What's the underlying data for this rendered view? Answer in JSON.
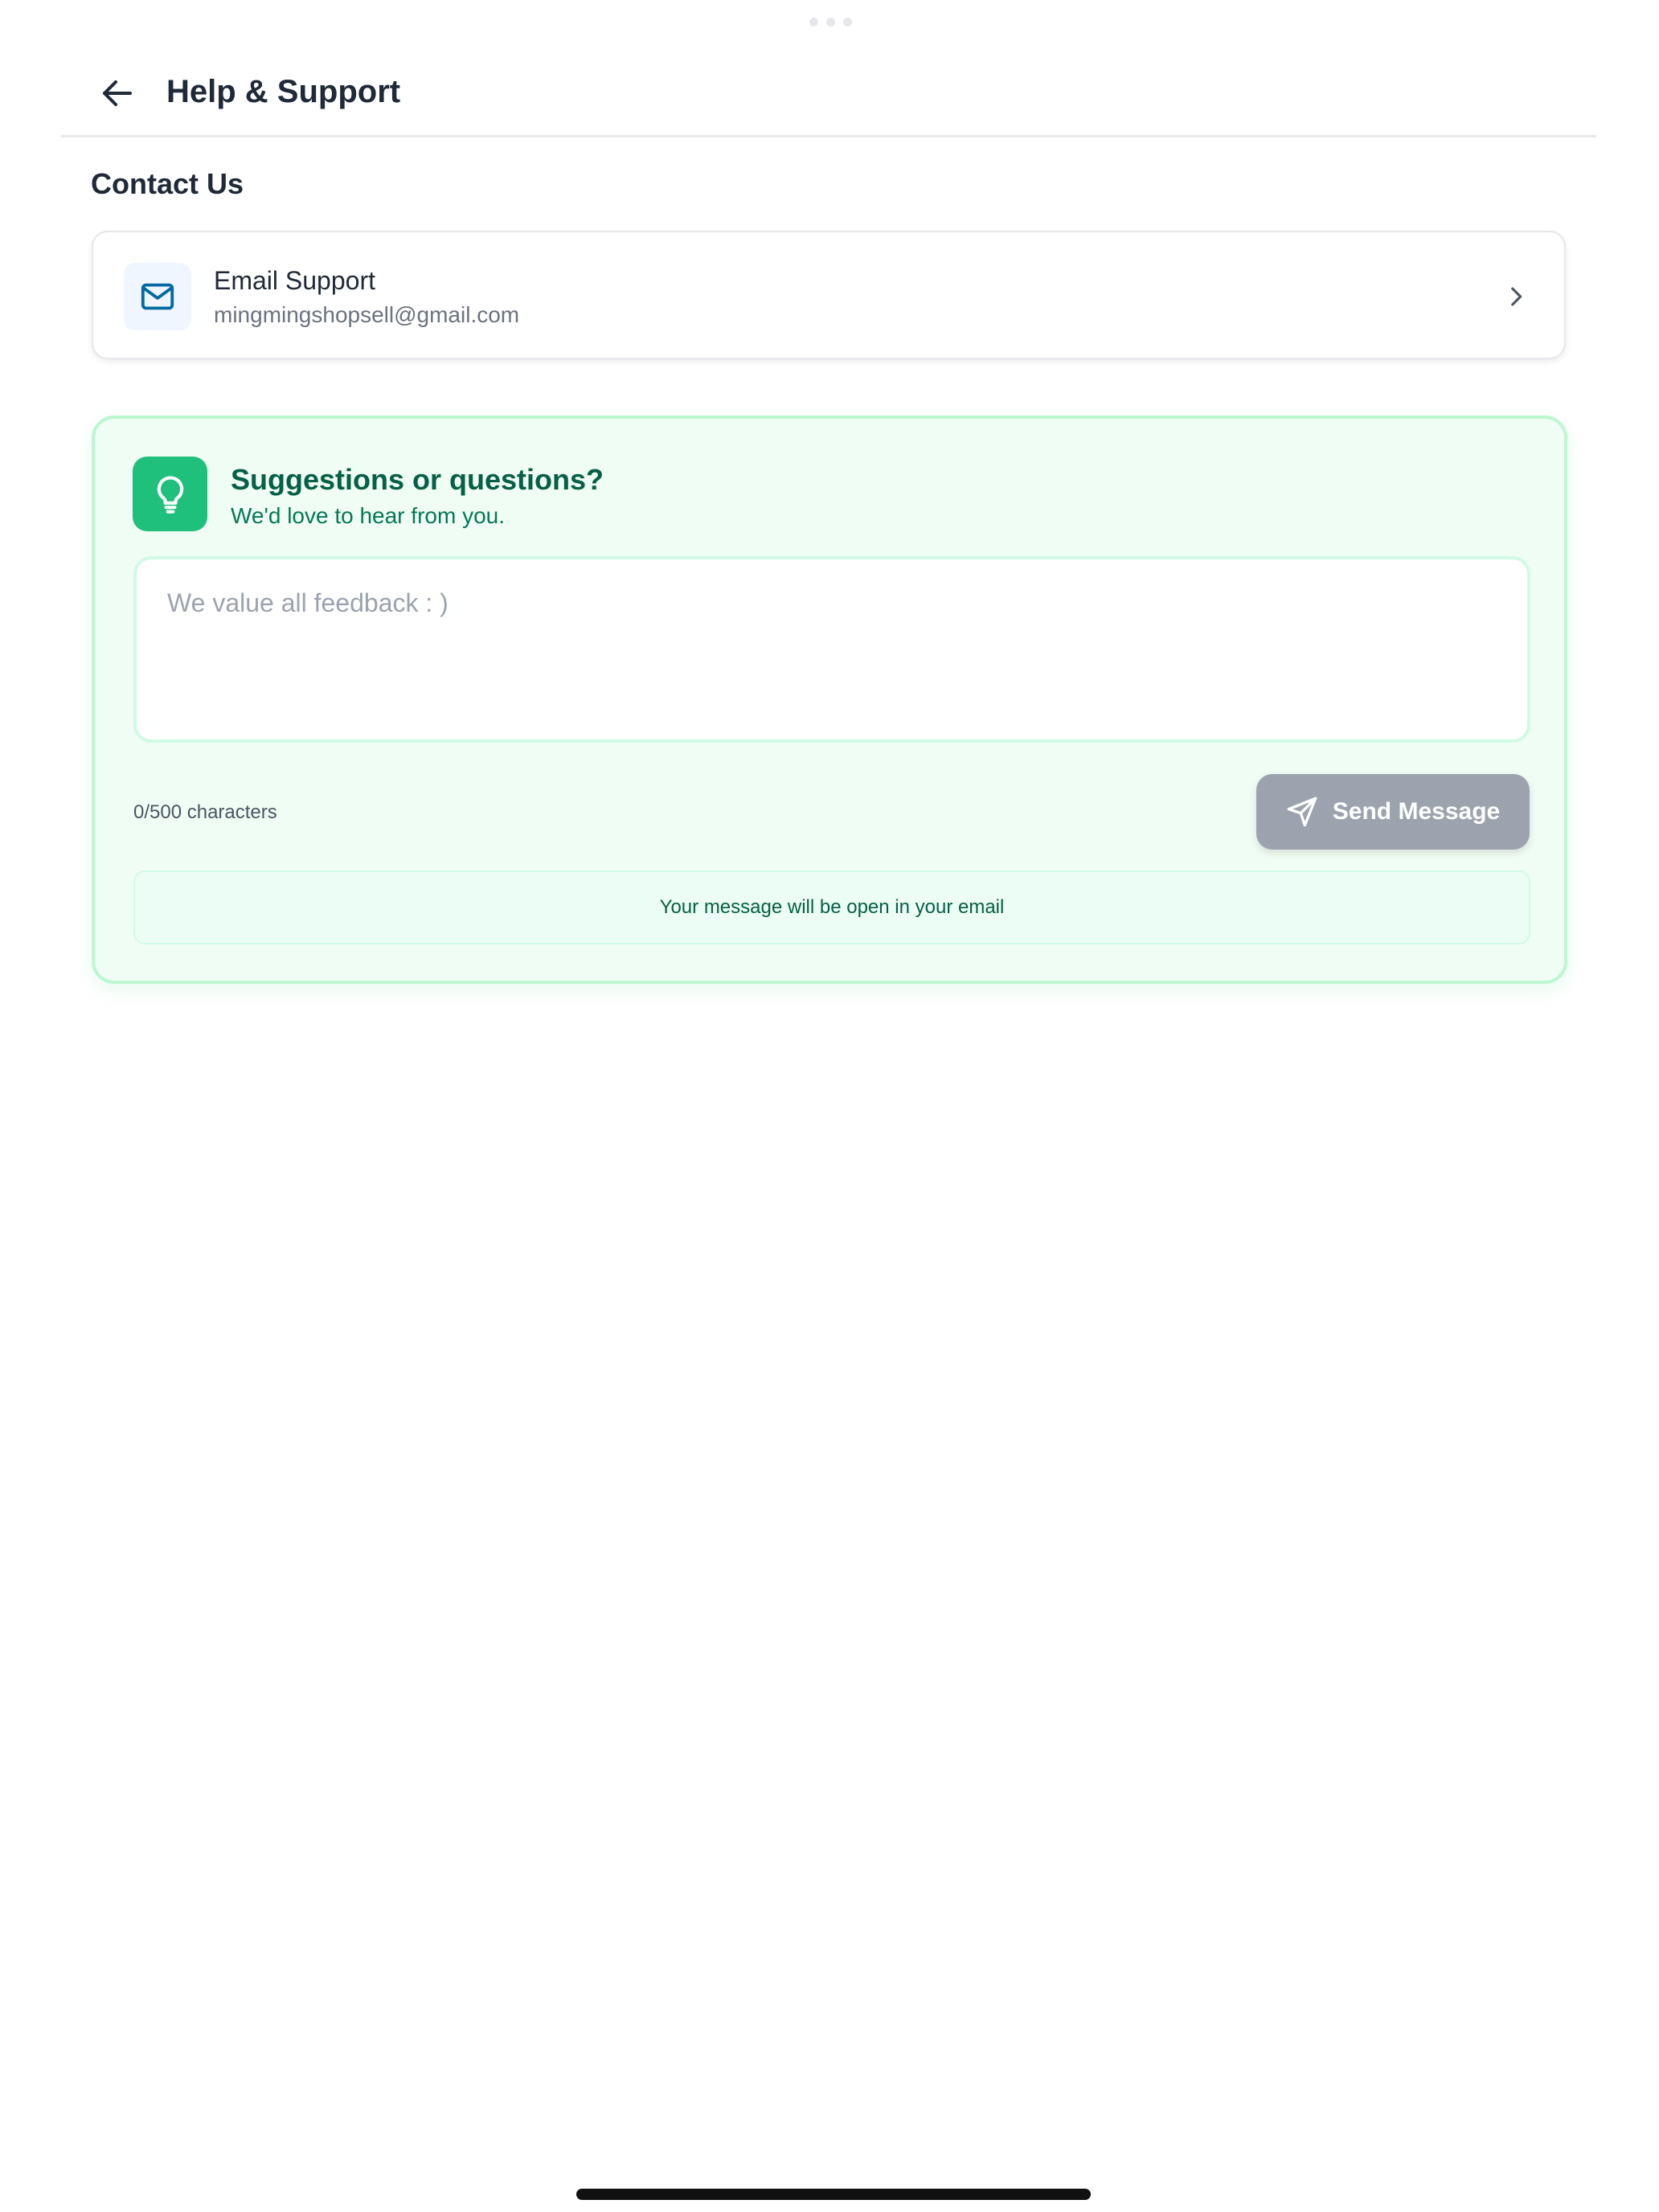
{
  "header": {
    "back_icon": "arrow-left-icon",
    "title": "Help & Support"
  },
  "contact": {
    "section_title": "Contact Us",
    "email_card": {
      "icon": "mail-icon",
      "title": "Email Support",
      "address": "mingmingshopsell@gmail.com",
      "chevron_icon": "chevron-right-icon"
    }
  },
  "feedback": {
    "icon": "lightbulb-icon",
    "title": "Suggestions or questions?",
    "subtitle": "We'd love to hear from you.",
    "input_value": "",
    "input_placeholder": "We value all feedback : )",
    "char_count": "0/500 characters",
    "send_icon": "send-icon",
    "send_label": "Send Message",
    "note": "Your message will be open in your email"
  },
  "colors": {
    "accent_green": "#1fbf7c",
    "card_bg": "#f0fdf4",
    "card_border": "#bbf7d0",
    "title_green": "#065f46",
    "send_disabled": "#9ca3af",
    "mail_blue": "#0369a1"
  }
}
